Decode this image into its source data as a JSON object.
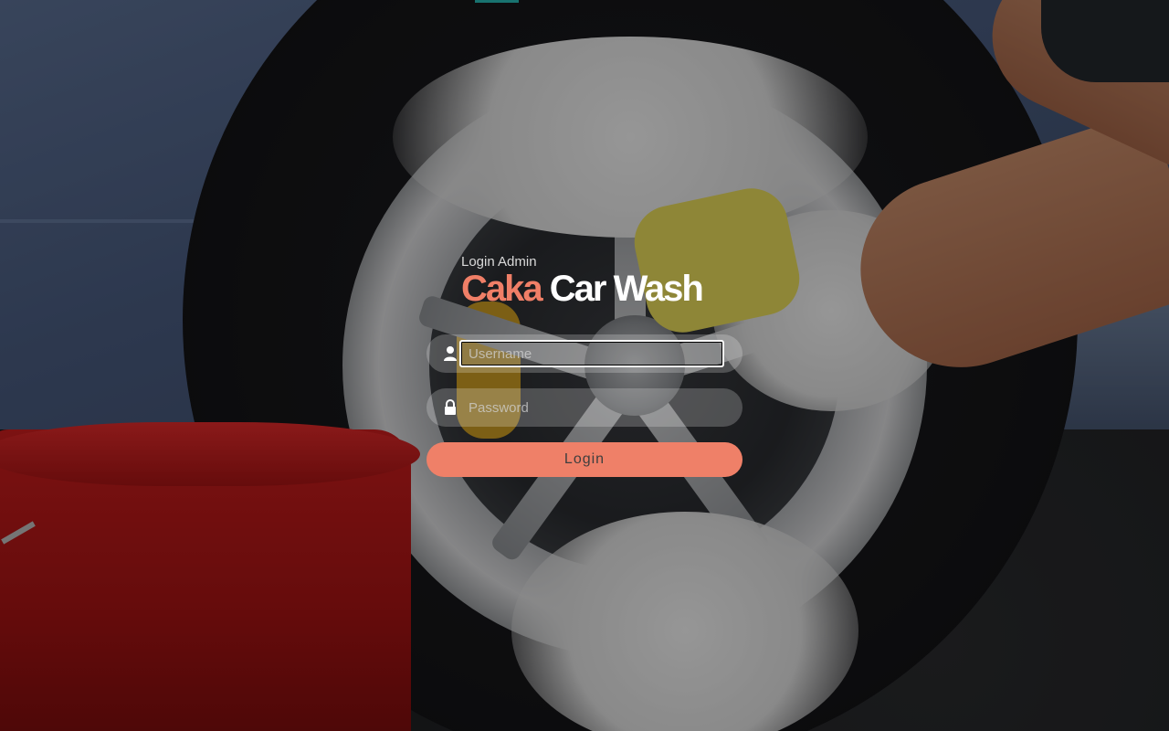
{
  "header": {
    "subtitle": "Login Admin",
    "brand_primary": "Caka",
    "brand_secondary": "Car Wash"
  },
  "form": {
    "username": {
      "value": "",
      "placeholder": "Username",
      "icon": "user-icon"
    },
    "password": {
      "value": "",
      "placeholder": "Password",
      "icon": "lock-icon"
    },
    "submit_label": "Login"
  },
  "colors": {
    "accent": "#ef8068",
    "brand_primary": "#f07f67",
    "brand_secondary": "#ffffff"
  }
}
